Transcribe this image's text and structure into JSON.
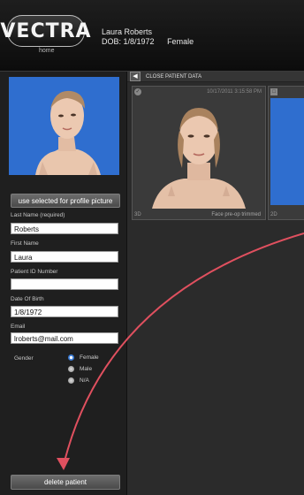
{
  "header": {
    "logo_text": "VECTRA",
    "home_label": "home",
    "patient_name": "Laura Roberts",
    "dob_label": "DOB: 1/8/1972",
    "gender_label": "Female"
  },
  "sidebar": {
    "use_button_label": "use selected for profile picture",
    "fields": {
      "last_name_label": "Last Name (required)",
      "last_name_value": "Roberts",
      "first_name_label": "First Name",
      "first_name_value": "Laura",
      "patient_id_label": "Patient ID Number",
      "patient_id_value": "",
      "dob_label": "Date Of Birth",
      "dob_value": "1/8/1972",
      "email_label": "Email",
      "email_value": "lroberts@mail.com"
    },
    "gender": {
      "label": "Gender",
      "options": [
        "Female",
        "Male",
        "N/A"
      ],
      "selected": "Female"
    },
    "delete_button_label": "delete patient"
  },
  "main": {
    "close_label": "CLOSE PATIENT DATA",
    "close_icon": "arrow-left-icon",
    "thumbnails": [
      {
        "type": "3D",
        "date": "10/17/2011 3:15:58 PM",
        "name": "Face pre-op trimmed"
      },
      {
        "type": "2D"
      }
    ]
  },
  "colors": {
    "annotation_arrow": "#e0505f",
    "photo_bg": "#2f6ecf",
    "radio_selected": "#3a7bd5"
  }
}
